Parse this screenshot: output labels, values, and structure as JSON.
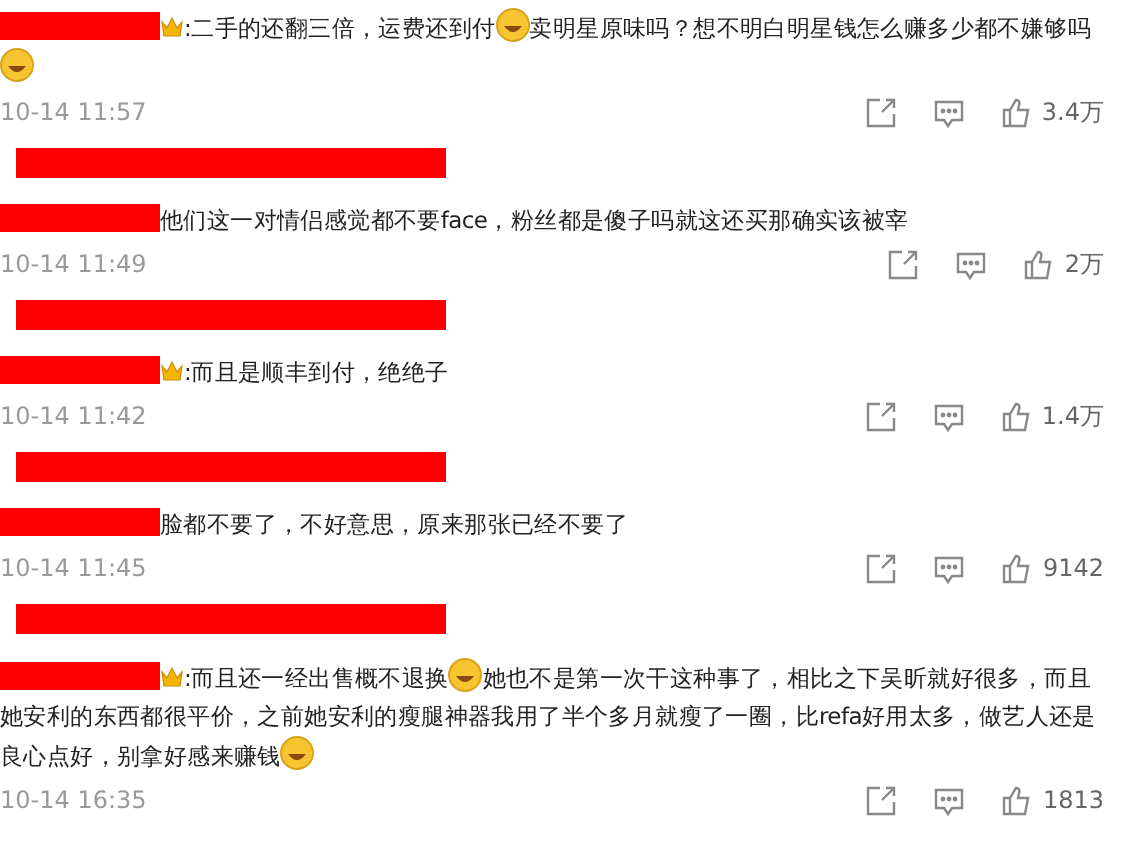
{
  "comments": [
    {
      "badge": true,
      "content": [
        {
          "kind": "text",
          "text": ":二手的还翻三倍，运费还到付"
        },
        {
          "kind": "emoji"
        },
        {
          "kind": "text",
          "text": "卖明星原味吗？想不明白明星钱怎么赚多少都不嫌够吗"
        },
        {
          "kind": "emoji"
        }
      ],
      "time": "10-14 11:57",
      "likes": "3.4万",
      "reply_redacted": true
    },
    {
      "badge": false,
      "content": [
        {
          "kind": "text",
          "text": "他们这一对情侣感觉都不要face，粉丝都是傻子吗就这还买那确实该被宰"
        }
      ],
      "time": "10-14 11:49",
      "likes": "2万",
      "reply_redacted": true
    },
    {
      "badge": true,
      "content": [
        {
          "kind": "text",
          "text": ":而且是顺丰到付，绝绝子"
        }
      ],
      "time": "10-14 11:42",
      "likes": "1.4万",
      "reply_redacted": true
    },
    {
      "badge": false,
      "content": [
        {
          "kind": "text",
          "text": "脸都不要了，不好意思，原来那张已经不要了"
        }
      ],
      "time": "10-14 11:45",
      "likes": "9142",
      "reply_redacted": true
    },
    {
      "badge": true,
      "content": [
        {
          "kind": "text",
          "text": ":而且还一经出售概不退换"
        },
        {
          "kind": "emoji"
        },
        {
          "kind": "text",
          "text": "她也不是第一次干这种事了，相比之下吴昕就好很多，而且她安利的东西都很平价，之前她安利的瘦腿神器我用了半个多月就瘦了一圈，比refa好用太多，做艺人还是良心点好，别拿好感来赚钱"
        },
        {
          "kind": "emoji"
        }
      ],
      "time": "10-14 16:35",
      "likes": "1813",
      "reply_redacted": false
    }
  ]
}
